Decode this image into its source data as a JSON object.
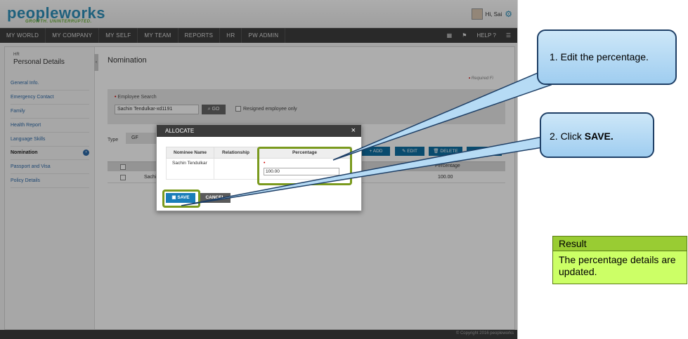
{
  "app": {
    "logo_main": "peopleworks",
    "logo_tagline": "GROWTH. UNINTERRUPTED.",
    "greeting": "Hi, Sai"
  },
  "nav": {
    "items": [
      "MY WORLD",
      "MY COMPANY",
      "MY SELF",
      "MY TEAM",
      "REPORTS",
      "HR",
      "PW ADMIN"
    ],
    "help": "HELP"
  },
  "sidebar": {
    "section": "HR",
    "title": "Personal Details",
    "items": [
      "General Info.",
      "Emergency Contact",
      "Family",
      "Health Report",
      "Language Skills",
      "Nomination",
      "Passport and Visa",
      "Policy Details"
    ],
    "active_index": 5
  },
  "page": {
    "title": "Nomination",
    "required_note": "Required Fi",
    "search_label": "Employee Search",
    "search_value": "Sachin Tendulkar-xd1191",
    "go_label": "GO",
    "resigned_label": "Resigned employee only",
    "type_label": "Type",
    "type_value": "GF",
    "actions": [
      "ADD",
      "EDIT",
      "DELETE",
      "ALLOCA"
    ],
    "grid_percentage_header": "Percentage",
    "grid_row_name": "Sachi",
    "grid_row_percentage": "100.00"
  },
  "modal": {
    "title": "ALLOCATE",
    "columns": [
      "Nominee Name",
      "Relationship",
      "Percentage"
    ],
    "rows": [
      {
        "nominee": "Sachin Tendulkar",
        "relationship": "",
        "percentage": "100.00"
      }
    ],
    "save_label": "SAVE",
    "cancel_label": "CANCEL"
  },
  "footer": {
    "copyright": "© Copyright 2016 peopleworks"
  },
  "callouts": {
    "step1": "1.  Edit the percentage.",
    "step2_prefix": "2.   Click ",
    "step2_bold": "SAVE."
  },
  "result": {
    "heading": "Result",
    "text": "The percentage details are updated."
  },
  "colors": {
    "highlight": "#7a9a1e",
    "callout_border": "#1e3f66",
    "result_head": "#99cc33",
    "result_body": "#ccff66",
    "primary_button": "#1a7db8"
  }
}
